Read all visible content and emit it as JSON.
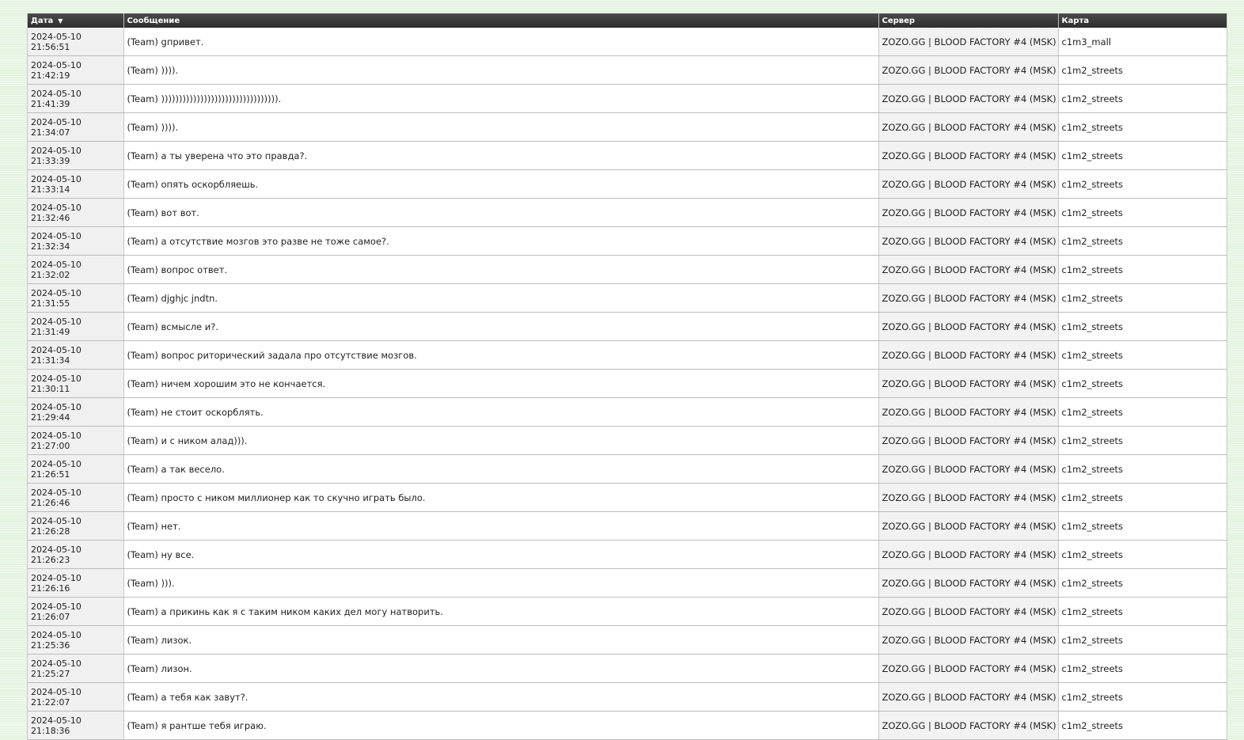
{
  "table": {
    "headers": {
      "date": "Дата",
      "message": "Сообщение",
      "server": "Сервер",
      "map": "Карта"
    },
    "sort_icon": "sort-down-arrow",
    "rows": [
      {
        "date": "2024-05-10",
        "time": "21:56:51",
        "message": "(Team) gпривет.",
        "server": "ZOZO.GG | BLOOD FACTORY #4 (MSK)",
        "map": "c1m3_mall"
      },
      {
        "date": "2024-05-10",
        "time": "21:42:19",
        "message": "(Team) )))).",
        "server": "ZOZO.GG | BLOOD FACTORY #4 (MSK)",
        "map": "c1m2_streets"
      },
      {
        "date": "2024-05-10",
        "time": "21:41:39",
        "message": "(Team) ))))))))))))))))))))))))))))))))).",
        "server": "ZOZO.GG | BLOOD FACTORY #4 (MSK)",
        "map": "c1m2_streets"
      },
      {
        "date": "2024-05-10",
        "time": "21:34:07",
        "message": "(Team) )))).",
        "server": "ZOZO.GG | BLOOD FACTORY #4 (MSK)",
        "map": "c1m2_streets"
      },
      {
        "date": "2024-05-10",
        "time": "21:33:39",
        "message": "(Team) а ты уверена что это правда?.",
        "server": "ZOZO.GG | BLOOD FACTORY #4 (MSK)",
        "map": "c1m2_streets"
      },
      {
        "date": "2024-05-10",
        "time": "21:33:14",
        "message": "(Team) опять оскорбляешь.",
        "server": "ZOZO.GG | BLOOD FACTORY #4 (MSK)",
        "map": "c1m2_streets"
      },
      {
        "date": "2024-05-10",
        "time": "21:32:46",
        "message": "(Team) вот вот.",
        "server": "ZOZO.GG | BLOOD FACTORY #4 (MSK)",
        "map": "c1m2_streets"
      },
      {
        "date": "2024-05-10",
        "time": "21:32:34",
        "message": "(Team) а отсутствие мозгов это разве не тоже самое?.",
        "server": "ZOZO.GG | BLOOD FACTORY #4 (MSK)",
        "map": "c1m2_streets"
      },
      {
        "date": "2024-05-10",
        "time": "21:32:02",
        "message": "(Team) вопрос ответ.",
        "server": "ZOZO.GG | BLOOD FACTORY #4 (MSK)",
        "map": "c1m2_streets"
      },
      {
        "date": "2024-05-10",
        "time": "21:31:55",
        "message": "(Team) djghjc jndtn.",
        "server": "ZOZO.GG | BLOOD FACTORY #4 (MSK)",
        "map": "c1m2_streets"
      },
      {
        "date": "2024-05-10",
        "time": "21:31:49",
        "message": "(Team) всмысле и?.",
        "server": "ZOZO.GG | BLOOD FACTORY #4 (MSK)",
        "map": "c1m2_streets"
      },
      {
        "date": "2024-05-10",
        "time": "21:31:34",
        "message": "(Team) вопрос риторический задала про отсутствие мозгов.",
        "server": "ZOZO.GG | BLOOD FACTORY #4 (MSK)",
        "map": "c1m2_streets"
      },
      {
        "date": "2024-05-10",
        "time": "21:30:11",
        "message": "(Team) ничем хорошим это не кончается.",
        "server": "ZOZO.GG | BLOOD FACTORY #4 (MSK)",
        "map": "c1m2_streets"
      },
      {
        "date": "2024-05-10",
        "time": "21:29:44",
        "message": "(Team) не стоит оскорблять.",
        "server": "ZOZO.GG | BLOOD FACTORY #4 (MSK)",
        "map": "c1m2_streets"
      },
      {
        "date": "2024-05-10",
        "time": "21:27:00",
        "message": "(Team) и с ником алад))).",
        "server": "ZOZO.GG | BLOOD FACTORY #4 (MSK)",
        "map": "c1m2_streets"
      },
      {
        "date": "2024-05-10",
        "time": "21:26:51",
        "message": "(Team) а так весело.",
        "server": "ZOZO.GG | BLOOD FACTORY #4 (MSK)",
        "map": "c1m2_streets"
      },
      {
        "date": "2024-05-10",
        "time": "21:26:46",
        "message": "(Team) просто с ником миллионер как то скучно играть было.",
        "server": "ZOZO.GG | BLOOD FACTORY #4 (MSK)",
        "map": "c1m2_streets"
      },
      {
        "date": "2024-05-10",
        "time": "21:26:28",
        "message": "(Team) нет.",
        "server": "ZOZO.GG | BLOOD FACTORY #4 (MSK)",
        "map": "c1m2_streets"
      },
      {
        "date": "2024-05-10",
        "time": "21:26:23",
        "message": "(Team) ну все.",
        "server": "ZOZO.GG | BLOOD FACTORY #4 (MSK)",
        "map": "c1m2_streets"
      },
      {
        "date": "2024-05-10",
        "time": "21:26:16",
        "message": "(Team) ))).",
        "server": "ZOZO.GG | BLOOD FACTORY #4 (MSK)",
        "map": "c1m2_streets"
      },
      {
        "date": "2024-05-10",
        "time": "21:26:07",
        "message": "(Team) а прикинь как я с таким ником каких дел могу натворить.",
        "server": "ZOZO.GG | BLOOD FACTORY #4 (MSK)",
        "map": "c1m2_streets"
      },
      {
        "date": "2024-05-10",
        "time": "21:25:36",
        "message": "(Team) лизок.",
        "server": "ZOZO.GG | BLOOD FACTORY #4 (MSK)",
        "map": "c1m2_streets"
      },
      {
        "date": "2024-05-10",
        "time": "21:25:27",
        "message": "(Team) лизон.",
        "server": "ZOZO.GG | BLOOD FACTORY #4 (MSK)",
        "map": "c1m2_streets"
      },
      {
        "date": "2024-05-10",
        "time": "21:22:07",
        "message": "(Team) а тебя как завут?.",
        "server": "ZOZO.GG | BLOOD FACTORY #4 (MSK)",
        "map": "c1m2_streets"
      },
      {
        "date": "2024-05-10",
        "time": "21:18:36",
        "message": "(Team) я рантше тебя играю.",
        "server": "ZOZO.GG | BLOOD FACTORY #4 (MSK)",
        "map": "c1m2_streets"
      }
    ]
  }
}
